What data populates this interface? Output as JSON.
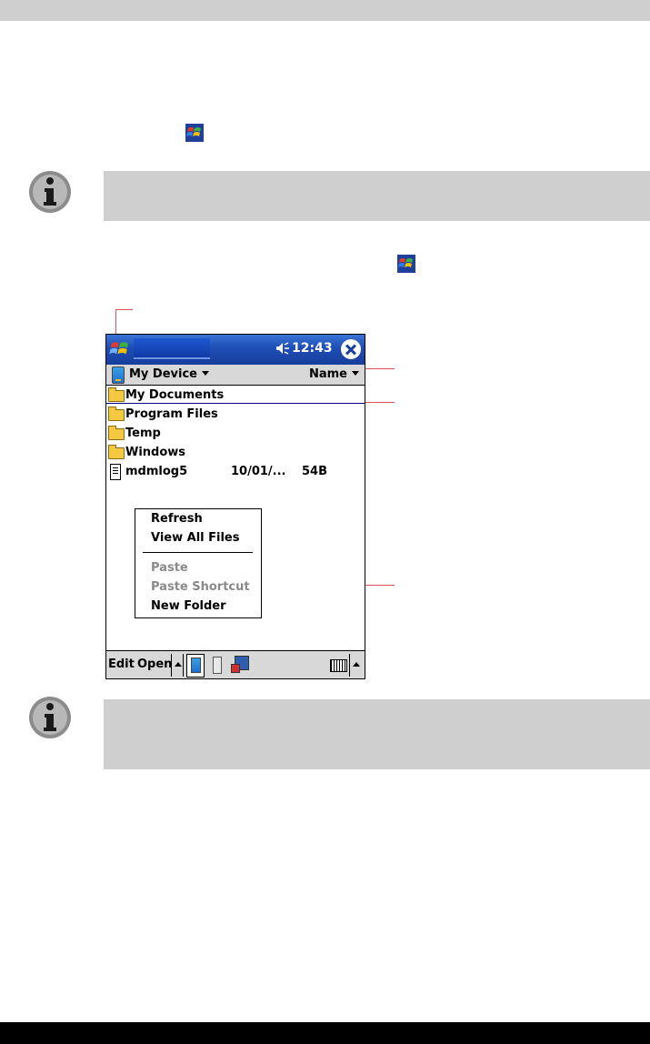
{
  "device": {
    "time": "12:43",
    "folder_label": "My Device",
    "sort_label": "Name"
  },
  "files": [
    {
      "name": "My Documents",
      "type": "folder"
    },
    {
      "name": "Program Files",
      "type": "folder"
    },
    {
      "name": "Temp",
      "type": "folder"
    },
    {
      "name": "Windows",
      "type": "folder"
    },
    {
      "name": "mdmlog5",
      "type": "file",
      "date": "10/01/...",
      "size": "54B"
    }
  ],
  "context_menu": {
    "items": [
      {
        "label": "Refresh",
        "enabled": true
      },
      {
        "label": "View All Files",
        "enabled": true
      },
      {
        "label": "Paste",
        "enabled": false
      },
      {
        "label": "Paste Shortcut",
        "enabled": false
      },
      {
        "label": "New Folder",
        "enabled": true
      }
    ]
  },
  "command_bar": {
    "edit_label": "Edit",
    "open_label": "Open"
  },
  "icons": {
    "start": "windows-flag-icon",
    "note": "info-icon",
    "speaker": "speaker-icon",
    "close": "close-icon",
    "keyboard": "keyboard-icon"
  },
  "colors": {
    "title_bar": "#1e4db4",
    "note_background": "#cfcfcf",
    "callout_line": "#e0505a"
  }
}
